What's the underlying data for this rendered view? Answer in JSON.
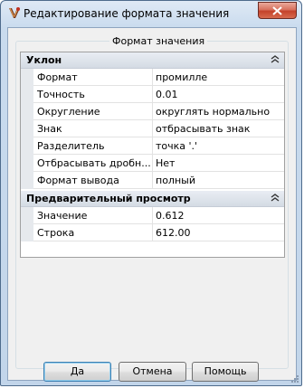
{
  "window": {
    "title": "Редактирование формата значения"
  },
  "group": {
    "caption": "Формат значения"
  },
  "categories": [
    {
      "label": "Уклон",
      "rows": [
        {
          "name": "Формат",
          "value": "промилле"
        },
        {
          "name": "Точность",
          "value": "0.01"
        },
        {
          "name": "Округление",
          "value": "округлять нормально"
        },
        {
          "name": "Знак",
          "value": "отбрасывать знак"
        },
        {
          "name": "Разделитель",
          "value": "точка '.'"
        },
        {
          "name": "Отбрасывать дробн...",
          "value": "Нет"
        },
        {
          "name": "Формат вывода",
          "value": "полный"
        }
      ]
    },
    {
      "label": "Предварительный просмотр",
      "rows": [
        {
          "name": "Значение",
          "value": "0.612"
        },
        {
          "name": "Строка",
          "value": "612.00"
        }
      ]
    }
  ],
  "buttons": {
    "ok": "Да",
    "cancel": "Отмена",
    "help": "Помощь"
  },
  "icons": {
    "app": "app-icon",
    "close": "close-icon",
    "collapse": "double-chevron-up-icon",
    "grip": "resize-grip-icon"
  },
  "colors": {
    "close_button": "#c4422a",
    "title_bar": "#c9dbee",
    "category_header": "#d4dbe4"
  }
}
